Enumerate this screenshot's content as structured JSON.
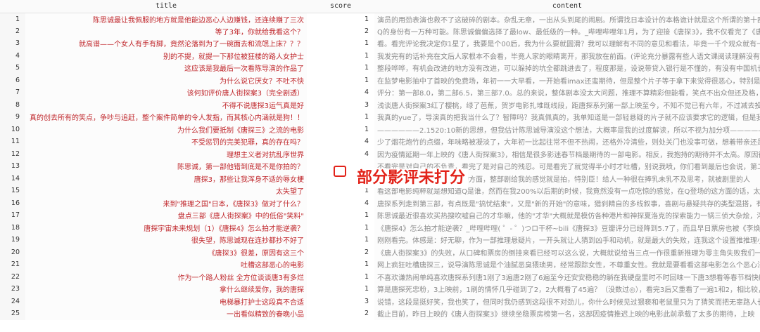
{
  "columns": {
    "index": "",
    "title": "title",
    "score": "score",
    "content": "content"
  },
  "annotation": {
    "text": "部分影评未打分",
    "color": "#e2231a"
  },
  "rows": [
    {
      "idx": "1",
      "title": "陈思诚最让我佩服的地方就是他能边恶心人边赚钱，还连续赚了三次",
      "score": "1",
      "content": "演员的用劲表演也救不了这破碎的剧本。杂乱无章，一出从头到尾的闹剧。所谓找日本设计的本格诡计就是这个所谓的第十四"
    },
    {
      "idx": "2",
      "title": "等了3年，你就给我看这个？",
      "score": "2",
      "content": "Q的身份有一万种可能。陈思诚偏偏选择了最low、最低级的一种。_哔哩哔哩年1月，为了迎接《唐探3》，我不仅看完了《唐探"
    },
    {
      "idx": "3",
      "title": "就高谱——个女人有手有脚，竟然沦落到为了一碗面去和流氓上床？？？",
      "score": "1",
      "content": "看。看完评论我决定你1星了，我要是个00后，我为什么要就圆滑？我可以理解有不同的意见和看法，毕竟一千个观众就有一千"
    },
    {
      "idx": "4",
      "title": "别的不提，就提一下那位被狂楼的路人女护士",
      "score": "1",
      "content": "我发完有的话补充在文后人家根本不会看，毕竟人家的眼睛离开，那我放在前面。(评论充分暴露有些人语文课阅读理解没有好"
    },
    {
      "idx": "5",
      "title": "这应该是我最后一次看陈导演的作品了",
      "score": "1",
      "content": "整段哗哗，有机会改进的地方没有改进，可以躲掉的坑全都跳进去了，程度那是，设说带贷入银行是不懂的，有没有中国机长"
    },
    {
      "idx": "6",
      "title": "为什么说它厌女？不吐不快",
      "score": "1",
      "content": "在监梦电影抽中了首映的免费场，年初一一大早看，一开始看imax还蛮期待，但是整个片子等于拿下来觉得很恶心，特别是充满了厌"
    },
    {
      "idx": "7",
      "title": "该何如评价唐人街探案3（完全剧透）",
      "score": "4",
      "content": "评分：第一部8.0，第二部6.5，第三部7.0。总的来说，整体剧本没太大问题，推理不算精彩但能看，笑点不出众但还及格，最后"
    },
    {
      "idx": "8",
      "title": "不得不说唐探3运气真是好",
      "score": "3",
      "content": "浅谈唐人街探案3红了樱桃，绿了芭蕉，贺岁电影扎堆既线段，距唐探系列第一部上映至今，不知不觉已有六年，不过减去投计"
    },
    {
      "idx": "9",
      "title": "真的创去所有的笑点，争吵与追赶，整个案件简单的令人发指，而其核心内涵就是狗！！",
      "score": "1",
      "content": "我真的yue了，导演真的把我当什么了？智障吗？我真佩真的，我单知道是一部轻悬疑的片子就不应该要求它的逻辑，但是我真"
    },
    {
      "idx": "10",
      "title": "为什么我们要抵制《唐探三》之流的电影",
      "score": "1",
      "content": "——————2.1520:10新的思想，但我估计陈思诚导演没这个想法，大概率是我的过度解读，所以不视为加分项——————2.15————"
    },
    {
      "idx": "11",
      "title": "不受惩罚的完美犯罪，真的存在吗？",
      "score": "4",
      "content": "少了烟花炮竹的点缀，年味略被凝淡了，大年初一比起往常不但不热闹，还格外冷清些，则处关门也没事可做，想着带亲还是过"
    },
    {
      "idx": "12",
      "title": "理想主义者对抗乱序世界",
      "score": "4",
      "content": "因为疫情延期一年上映的《唐人街探案3》，相信是很多影迷春节档最期待的一部电影。相反，我抱持的期待并不太高。原因很"
    },
    {
      "idx": "13",
      "title": "陈思诚，第一部他错到底是不是你拍的？",
      "score": "",
      "content": "不看完是对自己的不负责，看完了是对自己的残忍。可是看完了就觉得半小时才吐槽，别说我喷，你们看到最后也会说，第二部开始就觉得推理"
    },
    {
      "idx": "14",
      "title": "唐探3，那些让我浑身不适的辱女梗",
      "score": "1",
      "content": "过年了就回家了，很多槽点的方面，整部剧给我的感觉就是拍，特别臣！给人一种很在捧乳未乳不及思考，就被剧里的人"
    },
    {
      "idx": "15",
      "title": "太失望了",
      "score": "1",
      "content": "看这部电影纯粹就是想知道Q是谁，然而在我200%以后期的时候，我竟然没有一点吃惊的感觉，在Q登场的这方面的话，太平平无奇"
    },
    {
      "idx": "16",
      "title": "来到\"推理之国\"日本，《唐探3》做对了什么？",
      "score": "4",
      "content": "唐探系列走到第三部，有点既是\"搞忧结束\"，又是\"新的开始\"的意味，猎刹精自的多线叙事，喜剧与悬疑共存的类型混搭，有鼎盛"
    },
    {
      "idx": "17",
      "title": "盘点三部《唐人街探案》中的低俗\"笑料\"",
      "score": "1",
      "content": "陈思诚最近很喜欢买热搜吹嘘自己的才华嘛，他的\"才华\"大概就是模仿各种港片和神探夏洛克的探索能力一锅三侦大杂烩，浮穿"
    },
    {
      "idx": "18",
      "title": "唐探宇宙未来规划（1）《唐探4》怎么拍才能逆袭？",
      "score": "1",
      "content": "《唐探4》怎么拍才能逆袭？_哔哩哔哩( ゜- ゜)つロ干杯~bili《唐探3》豆瓣评分已经降到5.7了，而且早日票房也被《李焕英》"
    },
    {
      "idx": "19",
      "title": "很失望，陈思诚现在连抄都抄不好了",
      "score": "1",
      "content": "刚刚看完。体感是：好无聊，作为一部推理悬疑片，一开头就让人猜到凶手和动机，就是最大的失败，连我这个设置推推理小"
    },
    {
      "idx": "20",
      "title": "《唐探3》很差，原因有这三个",
      "score": "2",
      "content": "《唐人街探案3》的失败，从口碑和票房的倒挂来看已经可以这么说，大概就说给当三点一作很重新推理为零主角失败我们一个"
    },
    {
      "idx": "21",
      "title": "吐槽这部恶心的电影",
      "score": "1",
      "content": "网上疯狂吐槽唐探三，说导演陈思诚是个油腻恶臭猥琐男，经常跟踪女性，不尊重女性。我就是要看看这部电影怎么个恶心法，"
    },
    {
      "idx": "22",
      "title": "作为一个路人粉丝 全方位谈谈唐3有多烂",
      "score": "1",
      "content": "不喜欢谦热闹单纯喜欢唐探系列唐1刚了3遍唐2刚了6遍至今还安安稳稳的躺在我硬盘里时不时回味一下唐3想看等春节档快结束"
    },
    {
      "idx": "23",
      "title": "拿什么继续爱你，我的唐探",
      "score": "1",
      "content": "算是唐探死忠粉，3上映前，1刷的情怀几乎碰到了2，2大概看了45遍？（没数过◎），看完3后又重看了一遍1和2，相比较，3给"
    },
    {
      "idx": "24",
      "title": "电梯暴打护士这段真不合适",
      "score": "3",
      "content": "说错，这段是挺好笑，我也笑了，但同时我仍感到这段很不对劲儿，你什么时候见过猥亵和老鼠里只为了猜笑而把无辜路人长时间"
    },
    {
      "idx": "25",
      "title": "一出看似精致的春晚小品",
      "score": "2",
      "content": "截止目前，昨日上映的《唐人街探案3》继续坐稳票房榜第一名，这部因疫情推迟上映的电影此前承载了太多的期待，上映"
    }
  ]
}
